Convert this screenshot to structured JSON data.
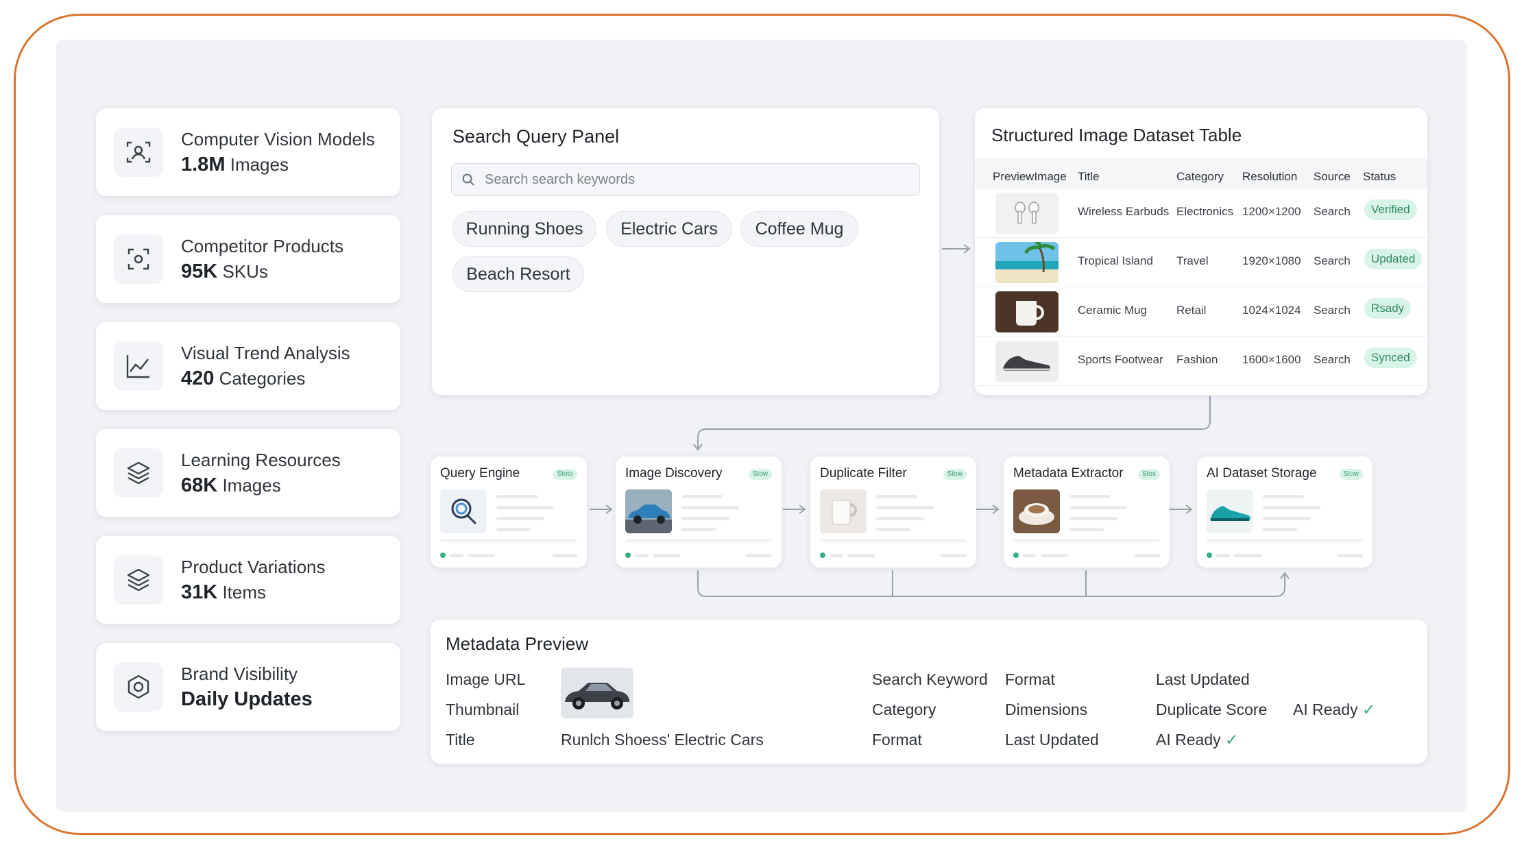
{
  "stats": [
    {
      "label": "Computer Vision Models",
      "value": "1.8M",
      "unit": "Images",
      "icon": "camera-focus-icon"
    },
    {
      "label": "Competitor Products",
      "value": "95K",
      "unit": "SKUs",
      "icon": "scan-icon"
    },
    {
      "label": "Visual Trend Analysis",
      "value": "420",
      "unit": "Categories",
      "icon": "trend-chart-icon"
    },
    {
      "label": "Learning Resources",
      "value": "68K",
      "unit": "Images",
      "icon": "layers-icon"
    },
    {
      "label": "Product Variations",
      "value": "31K",
      "unit": "Items",
      "icon": "layers-icon"
    },
    {
      "label": "Brand Visibility",
      "value": "Daily Updates",
      "unit": "",
      "icon": "hexagon-icon"
    }
  ],
  "search_panel": {
    "title": "Search Query Panel",
    "placeholder": "Search search keywords",
    "chips": [
      "Running Shoes",
      "Electric Cars",
      "Coffee Mug",
      "Beach Resort"
    ]
  },
  "table": {
    "title": "Structured Image Dataset Table",
    "headers": [
      "PreviewImage",
      "Title",
      "Category",
      "Resolution",
      "Source",
      "Status"
    ],
    "rows": [
      {
        "title": "Wireless Earbuds",
        "category": "Electronics",
        "resolution": "1200×1200",
        "source": "Search",
        "status": "Verified"
      },
      {
        "title": "Tropical Island",
        "category": "Travel",
        "resolution": "1920×1080",
        "source": "Search",
        "status": "Updated"
      },
      {
        "title": "Ceramic Mug",
        "category": "Retail",
        "resolution": "1024×1024",
        "source": "Search",
        "status": "Rsady"
      },
      {
        "title": "Sports Footwear",
        "category": "Fashion",
        "resolution": "1600×1600",
        "source": "Search",
        "status": "Synced"
      }
    ]
  },
  "pipeline": [
    {
      "title": "Query Engine",
      "status": "Stoto"
    },
    {
      "title": "Image Discovery",
      "status": "Stow"
    },
    {
      "title": "Duplicate Filter",
      "status": "Stow"
    },
    {
      "title": "Metadata Extractor",
      "status": "Stox"
    },
    {
      "title": "AI Dataset Storage",
      "status": "Stow"
    }
  ],
  "metadata": {
    "title": "Metadata Preview",
    "col1": [
      "Image URL",
      "Thumbnail",
      "Title"
    ],
    "title_value": "Runlch Shoess' Electric Cars",
    "col2": [
      "Search Keyword",
      "Category",
      "Format"
    ],
    "col3": [
      "Format",
      "Dimensions",
      "Last Updated"
    ],
    "col4": [
      "Last Updated",
      "Duplicate Score",
      "AI Ready"
    ],
    "col5": [
      "AI Ready"
    ],
    "check": "✓"
  },
  "colors": {
    "frame": "#d9752f",
    "badge_bg": "#d8f3e7",
    "badge_text": "#2f8a62"
  }
}
